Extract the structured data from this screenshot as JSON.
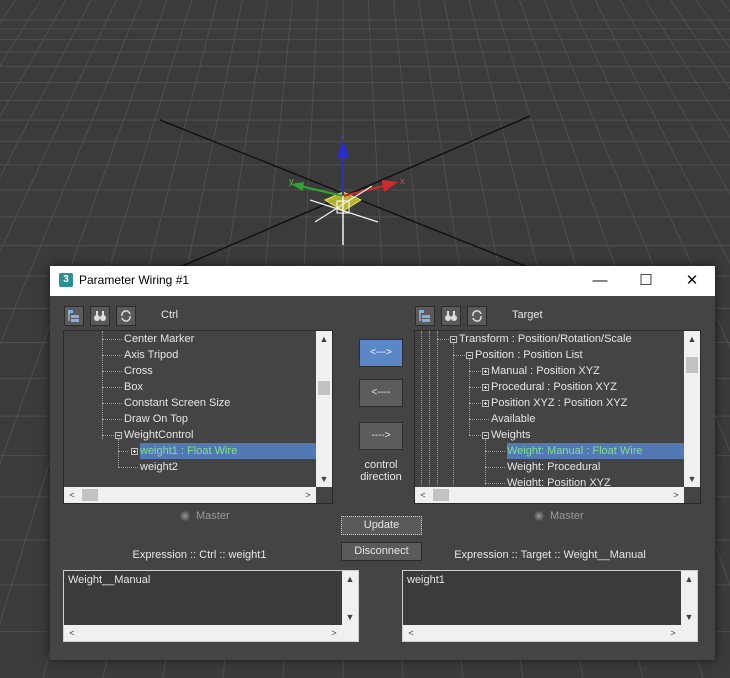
{
  "viewport": {
    "axis_x": "x",
    "axis_y": "y",
    "axis_z": "z",
    "colors": {
      "background": "#3b3b3b",
      "grid": "#4f4f4f",
      "grid_major": "#111111",
      "x_axis": "#d22a2a",
      "y_axis": "#2ea82e",
      "z_axis": "#2a2ad8",
      "plane": "#e8e83a"
    }
  },
  "window": {
    "title": "Parameter Wiring #1",
    "app_icon_label": "3",
    "minimize_glyph": "—",
    "maximize_glyph": "☐",
    "close_glyph": "✕"
  },
  "left_panel": {
    "caption": "Ctrl",
    "tree": [
      {
        "label": "Center Marker"
      },
      {
        "label": "Axis Tripod"
      },
      {
        "label": "Cross"
      },
      {
        "label": "Box"
      },
      {
        "label": "Constant Screen Size"
      },
      {
        "label": "Draw On Top"
      },
      {
        "label": "WeightControl"
      },
      {
        "label": "weight1 : Float Wire"
      },
      {
        "label": "weight2"
      }
    ],
    "master_label": "Master"
  },
  "right_panel": {
    "caption": "Target",
    "tree": [
      {
        "label": "Transform : Position/Rotation/Scale"
      },
      {
        "label": "Position : Position List"
      },
      {
        "label": "Manual : Position XYZ"
      },
      {
        "label": "Procedural : Position XYZ"
      },
      {
        "label": "Position XYZ : Position XYZ"
      },
      {
        "label": "Available"
      },
      {
        "label": "Weights"
      },
      {
        "label": "Weight: Manual : Float Wire"
      },
      {
        "label": "Weight: Procedural"
      },
      {
        "label": "Weight: Position XYZ"
      }
    ],
    "master_label": "Master"
  },
  "middle": {
    "bidirectional_label": "<--->",
    "left_label": "<----",
    "right_label": "---->",
    "control_direction_line1": "control",
    "control_direction_line2": "direction",
    "update_label": "Update",
    "disconnect_label": "Disconnect"
  },
  "expressions": {
    "left_caption": "Expression :: Ctrl :: weight1",
    "left_text": "Weight__Manual",
    "right_caption": "Expression :: Target :: Weight__Manual",
    "right_text": "weight1"
  },
  "scroll_arrows": {
    "up": "▲",
    "down": "▼",
    "left": "<",
    "right": ">"
  },
  "accent_color": "#5b87c7",
  "selected_text_color": "#7fe08a"
}
